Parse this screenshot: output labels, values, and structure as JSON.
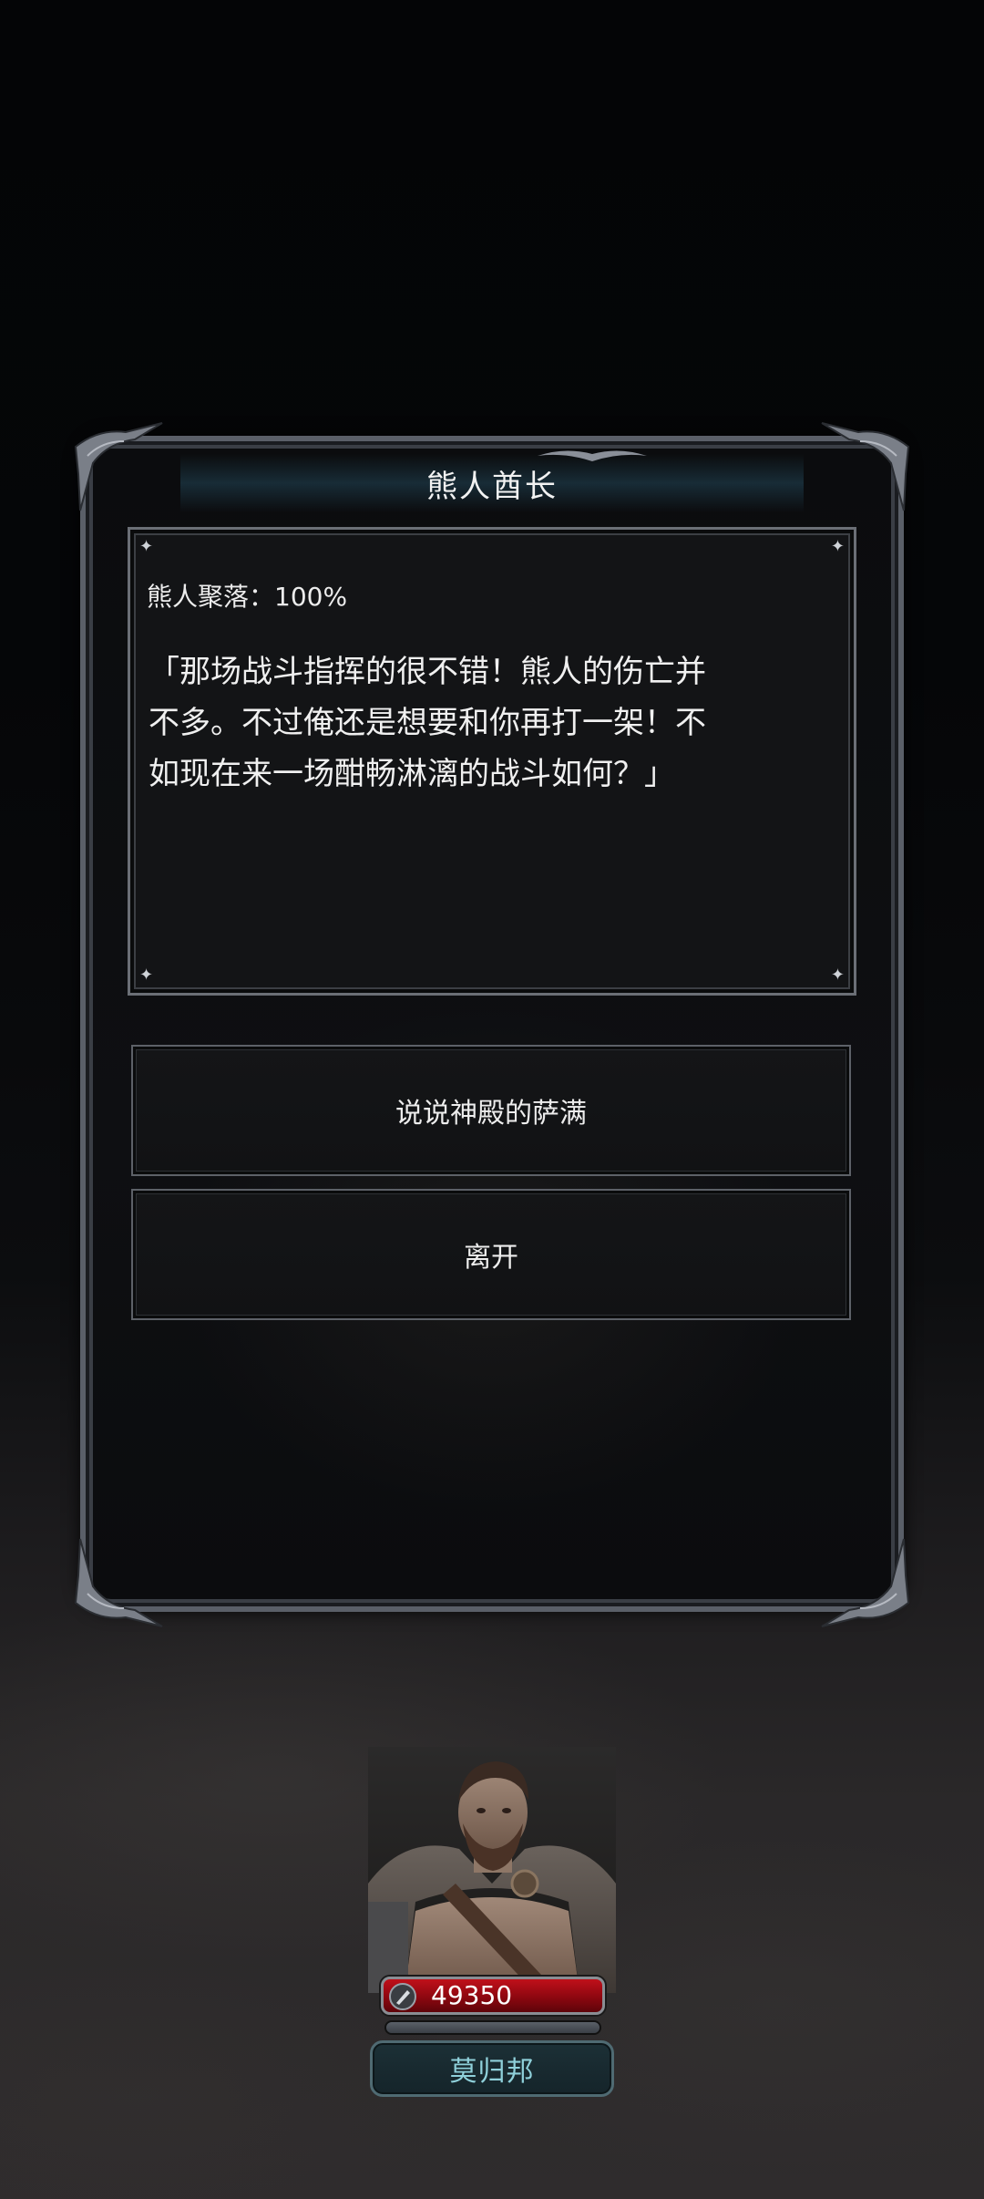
{
  "dialog": {
    "title": "熊人酋长",
    "progress_text": "熊人聚落：100%",
    "body_lines": [
      "「那场战斗指挥的很不错！熊人的伤亡并",
      "不多。不过俺还是想要和你再打一架！不",
      "如现在来一场酣畅淋漓的战斗如何？」"
    ],
    "options": [
      {
        "label": "说说神殿的萨满"
      },
      {
        "label": "离开"
      }
    ]
  },
  "character": {
    "hp": "49350",
    "name": "莫归邦",
    "hp_bar_color": "#b00d16",
    "name_color": "#8fd0da"
  }
}
